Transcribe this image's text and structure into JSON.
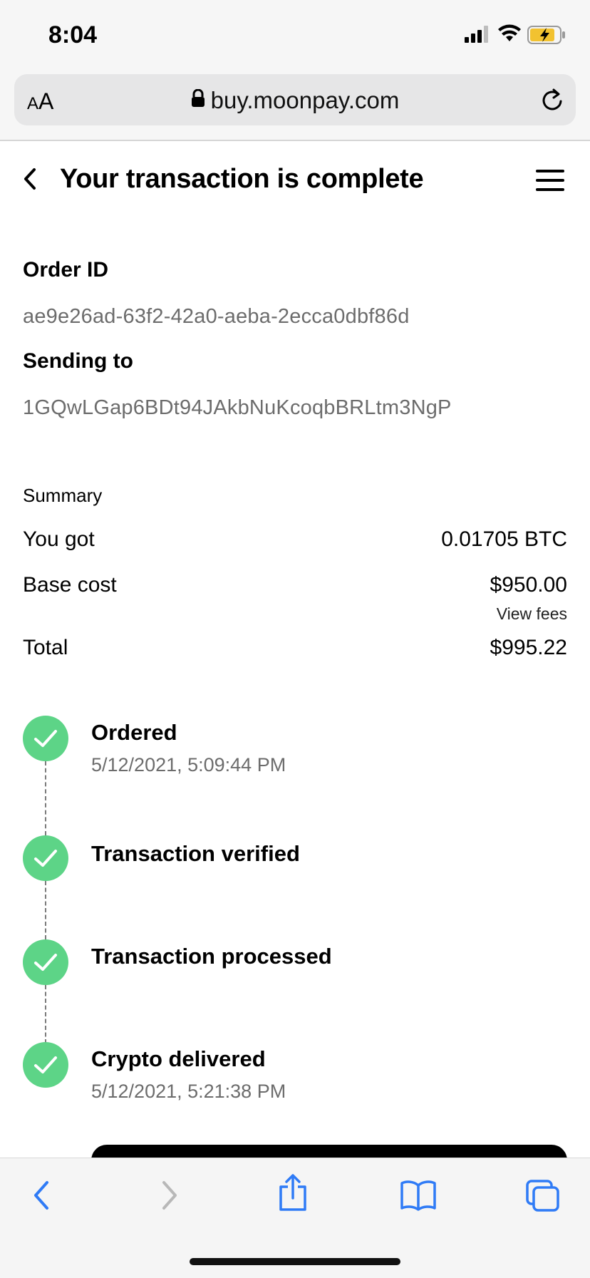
{
  "status": {
    "time": "8:04"
  },
  "browser": {
    "aa_label_small": "A",
    "aa_label_big": "A",
    "url": "buy.moonpay.com"
  },
  "header": {
    "title": "Your transaction is complete"
  },
  "order": {
    "order_id_label": "Order ID",
    "order_id": "ae9e26ad-63f2-42a0-aeba-2ecca0dbf86d",
    "sending_to_label": "Sending to",
    "sending_to": "1GQwLGap6BDt94JAkbNuKcoqbBRLtm3NgP"
  },
  "summary": {
    "title": "Summary",
    "you_got_label": "You got",
    "you_got_value": "0.01705 BTC",
    "base_cost_label": "Base cost",
    "base_cost_value": "$950.00",
    "view_fees": "View fees",
    "total_label": "Total",
    "total_value": "$995.22"
  },
  "steps": [
    {
      "title": "Ordered",
      "date": "5/12/2021, 5:09:44 PM"
    },
    {
      "title": "Transaction verified",
      "date": ""
    },
    {
      "title": "Transaction processed",
      "date": ""
    },
    {
      "title": "Crypto delivered",
      "date": "5/12/2021, 5:21:38 PM"
    }
  ],
  "colors": {
    "accent_green": "#5dd487",
    "ios_blue": "#2f7bf6"
  }
}
